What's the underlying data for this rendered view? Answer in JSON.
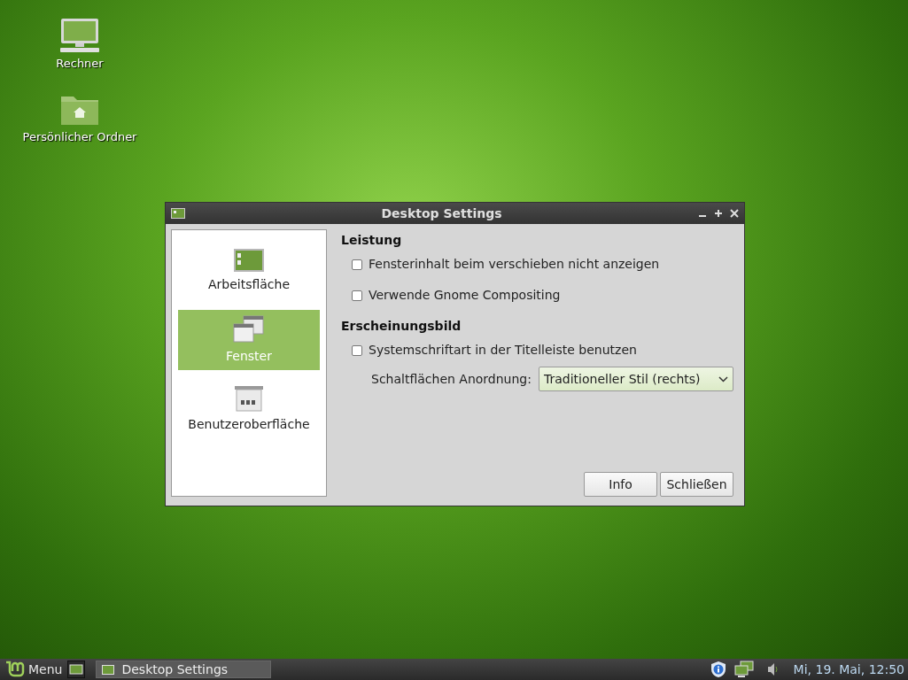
{
  "desktop_icons": [
    {
      "kind": "computer",
      "label": "Rechner"
    },
    {
      "kind": "folder",
      "label": "Persönlicher Ordner"
    }
  ],
  "window": {
    "title": "Desktop Settings",
    "sidebar": [
      {
        "kind": "desktop",
        "label": "Arbeitsfläche",
        "selected": false
      },
      {
        "kind": "windows",
        "label": "Fenster",
        "selected": true
      },
      {
        "kind": "interface",
        "label": "Benutzeroberfläche",
        "selected": false
      }
    ],
    "sections": [
      {
        "heading": "Leistung",
        "options": [
          {
            "kind": "checkbox",
            "label": "Fensterinhalt beim verschieben nicht anzeigen",
            "checked": false
          },
          {
            "kind": "checkbox",
            "label": "Verwende Gnome Compositing",
            "checked": false
          }
        ]
      },
      {
        "heading": "Erscheinungsbild",
        "options": [
          {
            "kind": "checkbox",
            "label": "Systemschriftart in der Titelleiste benutzen",
            "checked": false
          },
          {
            "kind": "dropdown",
            "label": "Schaltflächen Anordnung:",
            "value": "Traditioneller Stil (rechts)"
          }
        ]
      }
    ],
    "buttons": [
      "Info",
      "Schließen"
    ]
  },
  "taskbar": {
    "menu_label": "Menu",
    "tasks": [
      "Desktop Settings"
    ],
    "clock": "Mi, 19. Mai, 12:50"
  }
}
